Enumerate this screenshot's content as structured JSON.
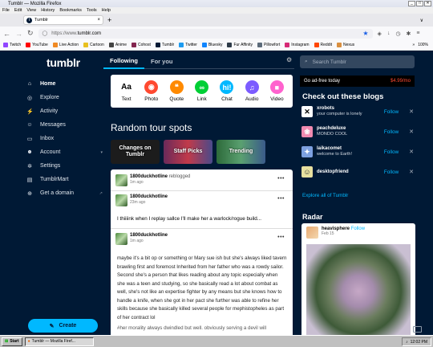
{
  "window": {
    "title": "Tumblr — Mozilla Firefox"
  },
  "menu": [
    "File",
    "Edit",
    "View",
    "History",
    "Bookmarks",
    "Tools",
    "Help"
  ],
  "browser": {
    "tab_title": "Tumblr",
    "url_prefix": "https://www.",
    "url_domain": "tumblr.com",
    "zoom": "100%",
    "bookmarks": [
      {
        "label": "Twitch",
        "color": "#9146ff"
      },
      {
        "label": "YouTube",
        "color": "#ff0000"
      },
      {
        "label": "Live Action",
        "color": "#f08a24"
      },
      {
        "label": "Cartoon",
        "color": "#e8c020"
      },
      {
        "label": "Anime",
        "color": "#444444"
      },
      {
        "label": "Cohost",
        "color": "#83254f"
      },
      {
        "label": "Tumblr",
        "color": "#001935"
      },
      {
        "label": "Twitter",
        "color": "#1d9bf0"
      },
      {
        "label": "Bluesky",
        "color": "#1185fe"
      },
      {
        "label": "Fur Affinity",
        "color": "#2e3b48"
      },
      {
        "label": "Pillowfort",
        "color": "#5c6b7a"
      },
      {
        "label": "Instagram",
        "color": "#d62976"
      },
      {
        "label": "Reddit",
        "color": "#ff4500"
      },
      {
        "label": "Nexus",
        "color": "#d98f40"
      }
    ]
  },
  "tumblr": {
    "logo": "tumblr",
    "nav": [
      {
        "label": "Home",
        "icon": "home-icon",
        "glyph": "⌂"
      },
      {
        "label": "Explore",
        "icon": "compass-icon",
        "glyph": "◎"
      },
      {
        "label": "Activity",
        "icon": "lightning-icon",
        "glyph": "⚡"
      },
      {
        "label": "Messages",
        "icon": "chat-icon",
        "glyph": "☺"
      },
      {
        "label": "Inbox",
        "icon": "inbox-icon",
        "glyph": "▭"
      },
      {
        "label": "Account",
        "icon": "person-icon",
        "glyph": "☻"
      },
      {
        "label": "Settings",
        "icon": "gear-icon",
        "glyph": "✲"
      },
      {
        "label": "TumblrMart",
        "icon": "shop-icon",
        "glyph": "▤"
      },
      {
        "label": "Get a domain",
        "icon": "globe-icon",
        "glyph": "⊕"
      }
    ],
    "create_label": "Create",
    "feed_tabs": [
      "Following",
      "For you"
    ],
    "composer": [
      {
        "label": "Text",
        "glyph": "Aa",
        "color": "#000000"
      },
      {
        "label": "Photo",
        "glyph": "◉",
        "color": "#ff4930"
      },
      {
        "label": "Quote",
        "glyph": "❝",
        "color": "#ff8a00"
      },
      {
        "label": "Link",
        "glyph": "∞",
        "color": "#00cf35"
      },
      {
        "label": "Chat",
        "glyph": "hi!",
        "color": "#00b8ff"
      },
      {
        "label": "Audio",
        "glyph": "♫",
        "color": "#7c5cff"
      },
      {
        "label": "Video",
        "glyph": "■",
        "color": "#ff62ce"
      }
    ],
    "random_tour_title": "Random tour spots",
    "tour_spots": [
      "Changes on Tumblr",
      "Staff Picks",
      "Trending"
    ],
    "post": {
      "reblogger": "1800duckhotline",
      "reblogged_text": "reblogged",
      "time1": "1m ago",
      "author2": "1800duckhotline",
      "time2": "23m ago",
      "text1": "I thiiiink when I replay sallce I'll make her a warlock/rogue build...",
      "author3": "1800duckhotline",
      "time3": "1m ago",
      "text2": "maybe it's a bit op or something or Mary sue ish but she's always liked tavern brawling first and foremost Inherited from her father who was a rowdy sailor. Second she's a person that likes reading about any topic especially when she was a teen and studying, so she basically read a lot about combat as well, she's not like an expertise fighter by any means but she knows how to handle a knife, when she got in her pact she further was able to refine her skills because she basically killed several people for mephistopheles as part of her contract lol",
      "tags": "#her morality always dwindled but well. obviously serving a devil will"
    },
    "search_placeholder": "Search Tumblr",
    "ad_free": {
      "label": "Go ad-free today",
      "price": "$4.99/mo"
    },
    "check_out_title": "Check out these blogs",
    "blogs": [
      {
        "name": "xrobots",
        "desc": "your computer is lonely",
        "glyph": "✕",
        "bg": "#ffffff",
        "fg": "#000000"
      },
      {
        "name": "peachdeluxe",
        "desc": "MONDO COOL",
        "glyph": "❀",
        "bg": "#f08ab0",
        "fg": "#ffffff"
      },
      {
        "name": "laikacomet",
        "desc": "welcome to Earth!",
        "glyph": "✦",
        "bg": "#7da0e0",
        "fg": "#ffffff"
      },
      {
        "name": "desktopfriend",
        "desc": "",
        "glyph": "☺",
        "bg": "#e8e0a0",
        "fg": "#333333"
      }
    ],
    "follow_label": "Follow",
    "explore_all": "Explore all of Tumblr",
    "radar_title": "Radar",
    "radar": {
      "name": "heavisphere",
      "follow": "Follow",
      "date": "Feb 15"
    }
  },
  "taskbar": {
    "start": "Start",
    "task": "Tumblr — Mozilla Firef...",
    "clock": "12:02 PM"
  }
}
